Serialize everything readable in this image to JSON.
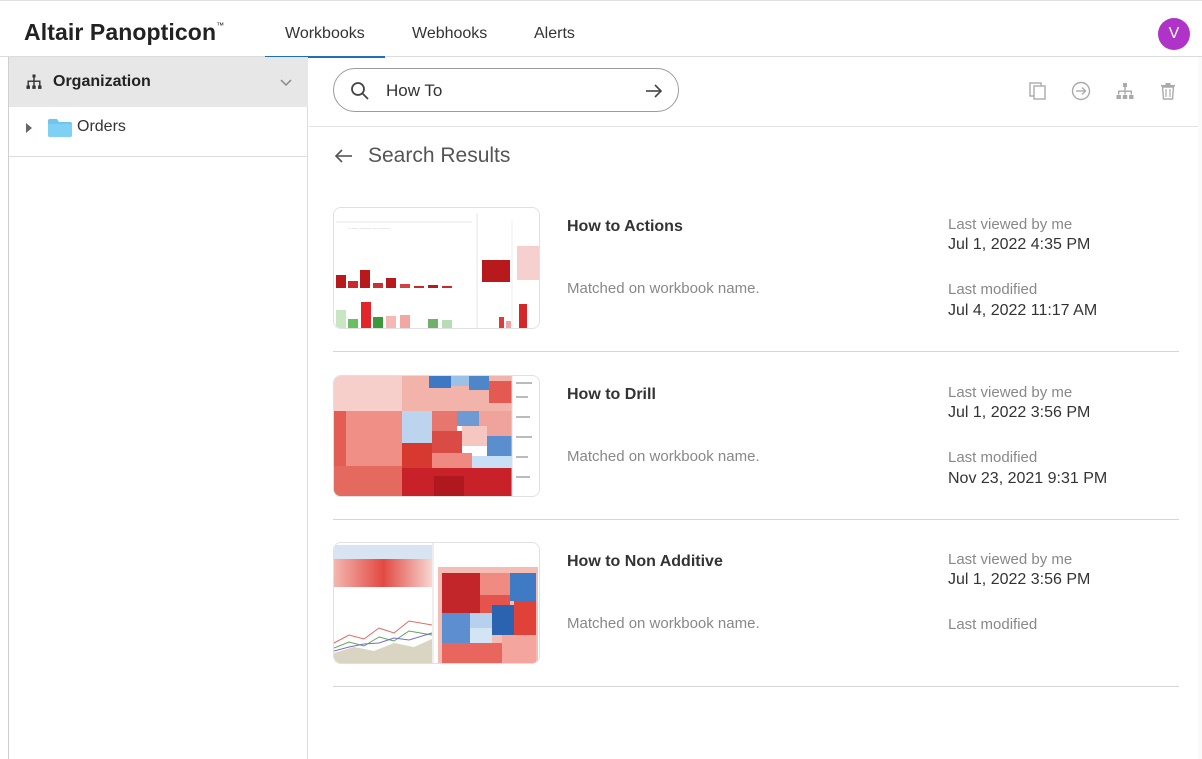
{
  "app": {
    "logo_text": "Altair Panopticon",
    "logo_mark": "™",
    "avatar_initial": "V",
    "avatar_color": "#b033c9",
    "accent": "#1e6fb8"
  },
  "tabs": [
    {
      "label": "Workbooks",
      "active": true
    },
    {
      "label": "Webhooks",
      "active": false
    },
    {
      "label": "Alerts",
      "active": false
    }
  ],
  "sidebar": {
    "header_icon": "organization-icon",
    "title": "Organization",
    "items": [
      {
        "label": "Orders",
        "icon": "folder-icon"
      }
    ]
  },
  "search": {
    "value": "How To",
    "placeholder": "Search"
  },
  "toolbar_icons": [
    "copy-icon",
    "move-icon",
    "hierarchy-icon",
    "trash-icon"
  ],
  "results": {
    "title": "Search Results",
    "items": [
      {
        "name": "How to Actions",
        "match": "Matched on workbook name.",
        "last_viewed_label": "Last viewed by me",
        "last_viewed": "Jul 1, 2022 4:35 PM",
        "last_modified_label": "Last modified",
        "last_modified": "Jul 4, 2022 11:17 AM"
      },
      {
        "name": "How to Drill",
        "match": "Matched on workbook name.",
        "last_viewed_label": "Last viewed by me",
        "last_viewed": "Jul 1, 2022 3:56 PM",
        "last_modified_label": "Last modified",
        "last_modified": "Nov 23, 2021 9:31 PM"
      },
      {
        "name": "How to Non Additive",
        "match": "Matched on workbook name.",
        "last_viewed_label": "Last viewed by me",
        "last_viewed": "Jul 1, 2022 3:56 PM",
        "last_modified_label": "Last modified",
        "last_modified": ""
      }
    ]
  }
}
